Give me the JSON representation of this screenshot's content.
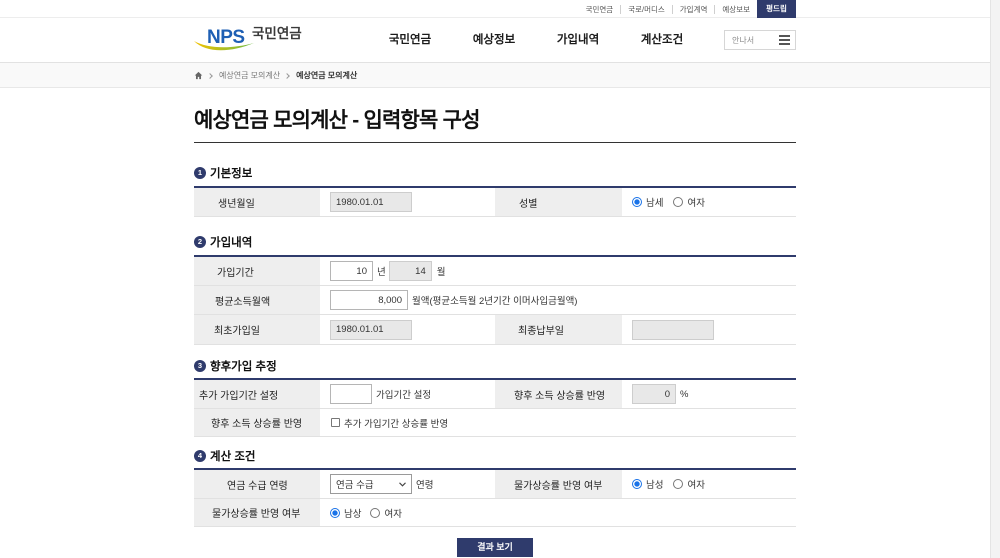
{
  "colors": {
    "navy": "#2f3b6c",
    "label_bg": "#eeeeee",
    "logo_blue": "#1e5fb4",
    "logo_green": "#6dbb45",
    "radio_selected": "#1a73e8"
  },
  "topbar": {
    "links": [
      {
        "label": "국민연금"
      },
      {
        "label": "국로/머디스"
      },
      {
        "label": "가입계역"
      },
      {
        "label": "예상보보"
      }
    ],
    "button_label": "평드립"
  },
  "header": {
    "logo": {
      "mark": "NPS",
      "name": "국민연금"
    },
    "nav": [
      {
        "label": "국민연금"
      },
      {
        "label": "예상정보"
      },
      {
        "label": "가입내역"
      },
      {
        "label": "계산조건"
      }
    ],
    "search": {
      "placeholder": "안나서",
      "menu_icon": "hamburger-icon"
    }
  },
  "breadcrumb": {
    "home_icon": "home-icon",
    "items": [
      {
        "label": "예상연금 모의계산"
      },
      {
        "label": "예상연금 모의계산"
      }
    ]
  },
  "page_title": "예상연금 모의계산 - 입력항목 구성",
  "sections": {
    "basic": {
      "number": "1",
      "title": "기본정보",
      "birth": {
        "label": "생년월일",
        "value": "1980.01.01"
      },
      "gender": {
        "label": "성별",
        "options": [
          {
            "label": "남세",
            "checked": true
          },
          {
            "label": "여자",
            "checked": false
          }
        ]
      }
    },
    "enrollment": {
      "number": "2",
      "title": "가입내역",
      "period": {
        "label": "가입기간",
        "years": "10",
        "years_unit": "년",
        "months": "14",
        "months_unit": "월"
      },
      "avg_income": {
        "label": "평균소득월액",
        "value": "8,000",
        "note": "월액(평균소득월 2년기간 이머사입금월액)"
      },
      "first_date": {
        "label": "최초가입일",
        "value": "1980.01.01"
      },
      "last_payment": {
        "label": "최종납부일",
        "value": ""
      }
    },
    "future": {
      "number": "3",
      "title": "향후가입 추정",
      "extra_period": {
        "label": "추가 가입기간 설정",
        "value": "",
        "suffix": "가입기간 설정"
      },
      "income_growth": {
        "label": "향후 소득 상승률 반영",
        "value": "0",
        "unit": "%"
      },
      "growth_apply": {
        "label": "향후 소득 상승률 반영",
        "checkbox_label": "추가 가입기간 상승률 반영",
        "checked": false
      }
    },
    "calc": {
      "number": "4",
      "title": "계산 조건",
      "age": {
        "label": "연금 수급 연령",
        "selected": "연금 수급",
        "suffix": "연령",
        "icon": "chevron-down-icon"
      },
      "inflation_a": {
        "label": "물가상승률 반영 여부",
        "options": [
          {
            "label": "남성",
            "checked": true
          },
          {
            "label": "여자",
            "checked": false
          }
        ]
      },
      "inflation_b": {
        "label": "물가상승률 반영 여부",
        "options": [
          {
            "label": "남상",
            "checked": true
          },
          {
            "label": "여자",
            "checked": false
          }
        ]
      }
    }
  },
  "submit_label": "결과 보기"
}
